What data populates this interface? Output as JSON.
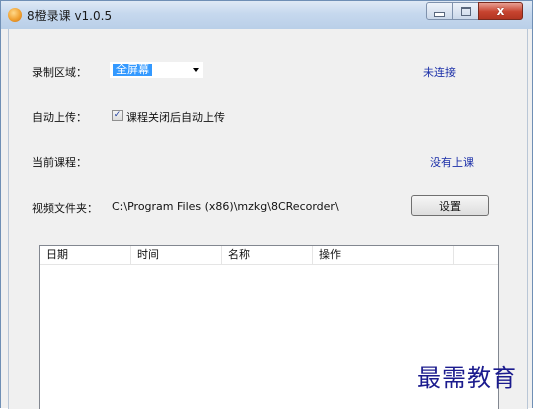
{
  "window": {
    "title": "8橙录课 v1.0.5",
    "close_glyph": "x"
  },
  "form": {
    "record_area_label": "录制区域：",
    "record_area_value": "全屏幕",
    "connection_status": "未连接",
    "auto_upload_label": "自动上传：",
    "auto_upload_checked_glyph": "✓",
    "auto_upload_option": "课程关闭后自动上传",
    "current_course_label": "当前课程：",
    "course_status": "没有上课",
    "video_folder_label": "视频文件夹：",
    "video_folder_path": "C:\\Program Files (x86)\\mzkg\\8CRecorder\\",
    "settings_button": "设置"
  },
  "table": {
    "columns": [
      "日期",
      "时间",
      "名称",
      "操作"
    ]
  },
  "watermark": "最需教育",
  "icons": {
    "app": "orange-app-icon",
    "minimize": "minimize-icon",
    "maximize": "maximize-icon",
    "close": "close-icon",
    "dropdown": "chevron-down-icon",
    "check": "checkmark-icon"
  }
}
